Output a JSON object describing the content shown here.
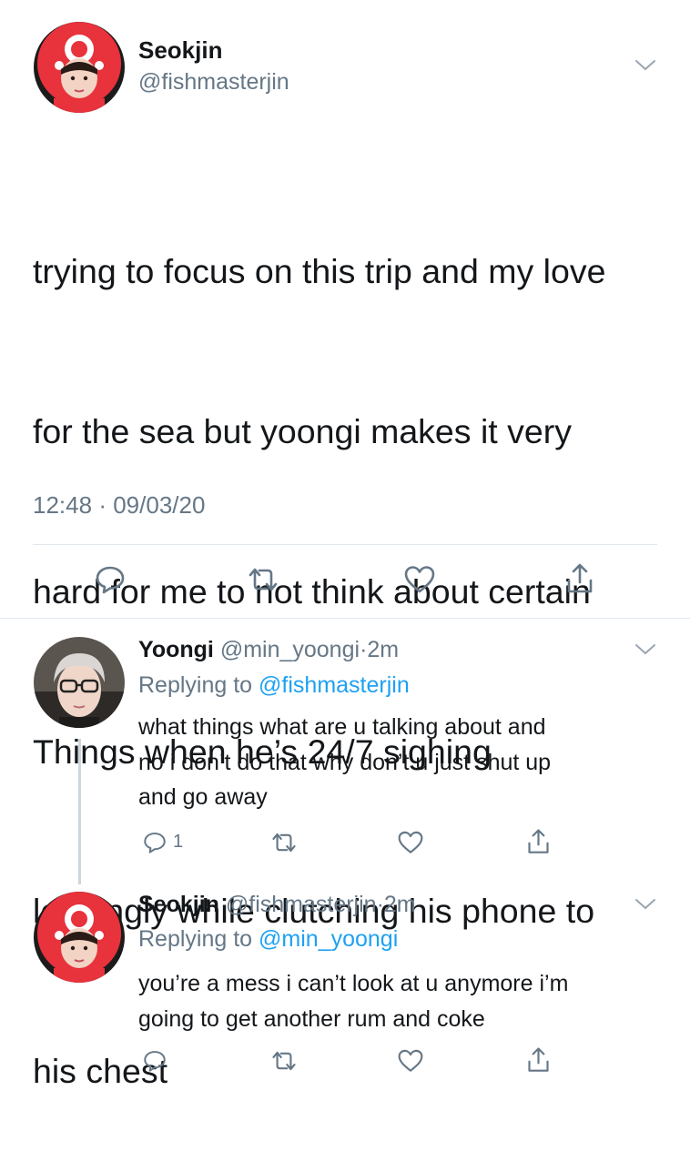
{
  "main_tweet": {
    "name": "Seokjin",
    "handle": "@fishmasterjin",
    "text": "trying to focus on this trip and my love for the sea but yoongi makes it very hard for me to not think about certain Things when he’s 24/7 sighing longingly while clutching his phone to his chest",
    "lines": [
      "trying to focus on this trip and my love",
      "for the sea but yoongi makes it very",
      "hard for me to not think about certain",
      "Things when he’s 24/7 sighing",
      "longingly while clutching his phone to",
      "his chest"
    ],
    "time": "12:48",
    "separator": "·",
    "date": "09/03/20",
    "icons": [
      "reply-icon",
      "retweet-icon",
      "like-icon",
      "share-icon"
    ]
  },
  "replies": [
    {
      "name": "Yoongi",
      "handle": "@min_yoongi",
      "separator": "·",
      "age": "2m",
      "replying_prefix": "Replying to",
      "replying_to": "@fishmasterjin",
      "lines": [
        "what things what are u talking about and",
        "no i don’t do that why don’t u just shut up",
        "and go away"
      ],
      "reply_count": "1"
    },
    {
      "name": "Seokjin",
      "handle": "@fishmasterjin",
      "separator": "·",
      "age": "2m",
      "replying_prefix": "Replying to",
      "replying_to": "@min_yoongi",
      "lines": [
        "you’re a mess i can’t look at u anymore i’m",
        "going to get another rum and coke"
      ],
      "reply_count": ""
    }
  ],
  "colors": {
    "text": "#14171a",
    "secondary": "#657786",
    "link": "#1da1f2",
    "divider": "#e1e8ed"
  }
}
